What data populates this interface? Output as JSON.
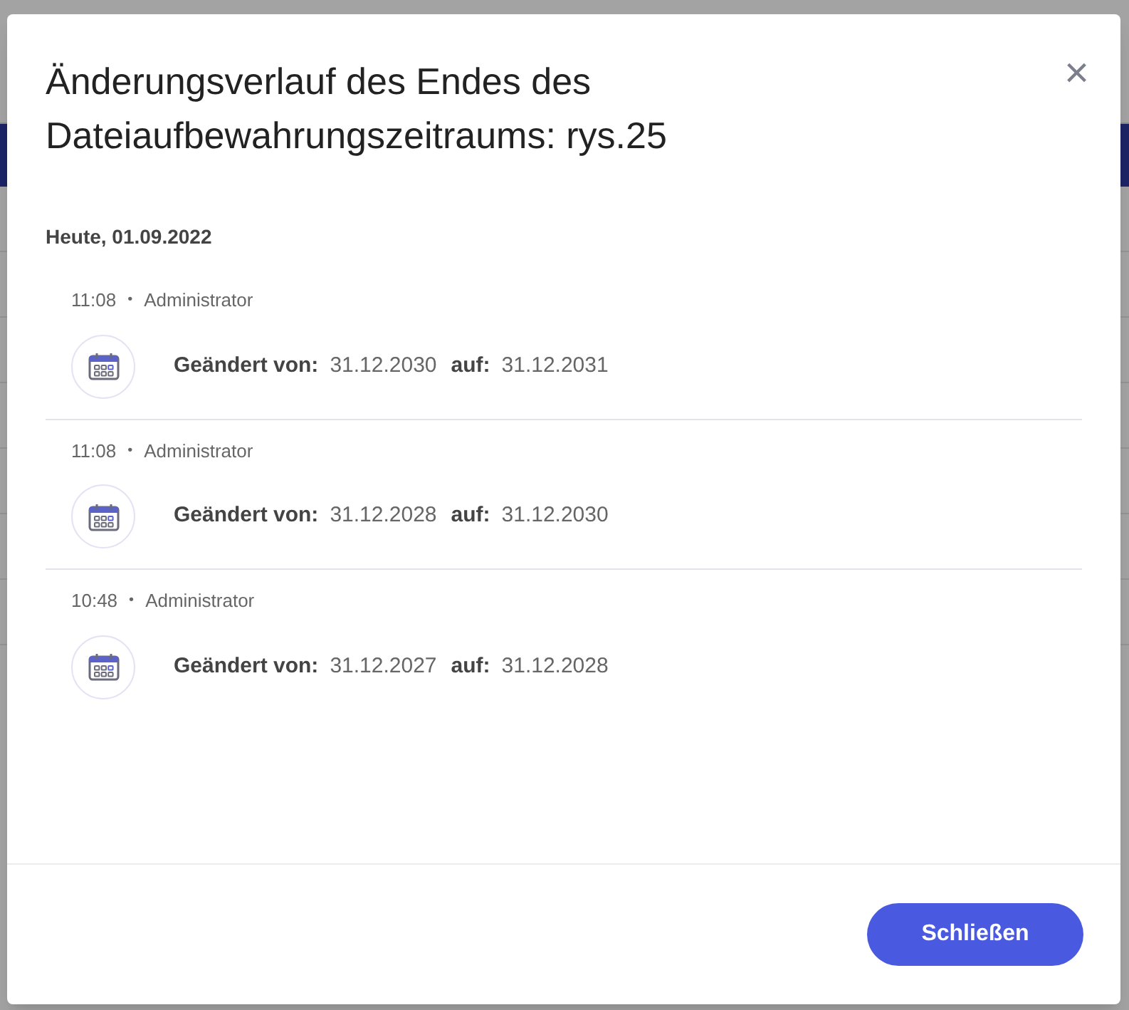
{
  "dialog": {
    "title": "Änderungsverlauf des Endes des Dateiaufbewahrungszeitraums: rys.25",
    "close_label": "×"
  },
  "day": {
    "label": "Heute, 01.09.2022"
  },
  "entries": [
    {
      "time": "11:08",
      "separator": "•",
      "user": "Administrator",
      "from_label": "Geändert von:",
      "from": "31.12.2030",
      "to_label": "auf:",
      "to": "31.12.2031"
    },
    {
      "time": "11:08",
      "separator": "•",
      "user": "Administrator",
      "from_label": "Geändert von:",
      "from": "31.12.2028",
      "to_label": "auf:",
      "to": "31.12.2030"
    },
    {
      "time": "10:48",
      "separator": "•",
      "user": "Administrator",
      "from_label": "Geändert von:",
      "from": "31.12.2027",
      "to_label": "auf:",
      "to": "31.12.2028"
    }
  ],
  "footer": {
    "button": "Schließen"
  }
}
